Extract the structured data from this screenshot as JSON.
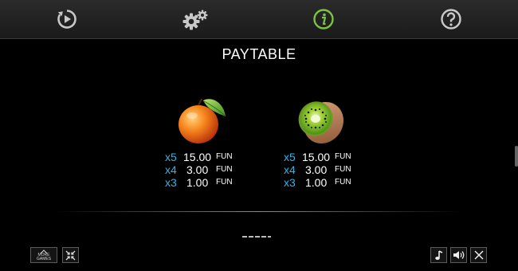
{
  "toolbar": {
    "icons": [
      "replay-icon",
      "settings-gear-icon",
      "info-icon",
      "help-question-icon"
    ],
    "active_icon": "info-icon",
    "active_color": "#7cc242"
  },
  "paytable": {
    "title": "PAYTABLE",
    "symbols": [
      {
        "name": "orange",
        "icon": "orange-fruit-icon",
        "payouts": [
          {
            "mult": "x5",
            "amount": "15.00",
            "currency": "FUN"
          },
          {
            "mult": "x4",
            "amount": "3.00",
            "currency": "FUN"
          },
          {
            "mult": "x3",
            "amount": "1.00",
            "currency": "FUN"
          }
        ]
      },
      {
        "name": "kiwi",
        "icon": "kiwi-fruit-icon",
        "payouts": [
          {
            "mult": "x5",
            "amount": "15.00",
            "currency": "FUN"
          },
          {
            "mult": "x4",
            "amount": "3.00",
            "currency": "FUN"
          },
          {
            "mult": "x3",
            "amount": "1.00",
            "currency": "FUN"
          }
        ]
      }
    ],
    "multiplier_color": "#2fb6e9"
  },
  "footer": {
    "more_games_line1": "MORE",
    "more_games_line2": "GAMES",
    "icons": [
      "collapse-arrows-icon",
      "music-note-icon",
      "speaker-icon",
      "close-icon"
    ]
  }
}
